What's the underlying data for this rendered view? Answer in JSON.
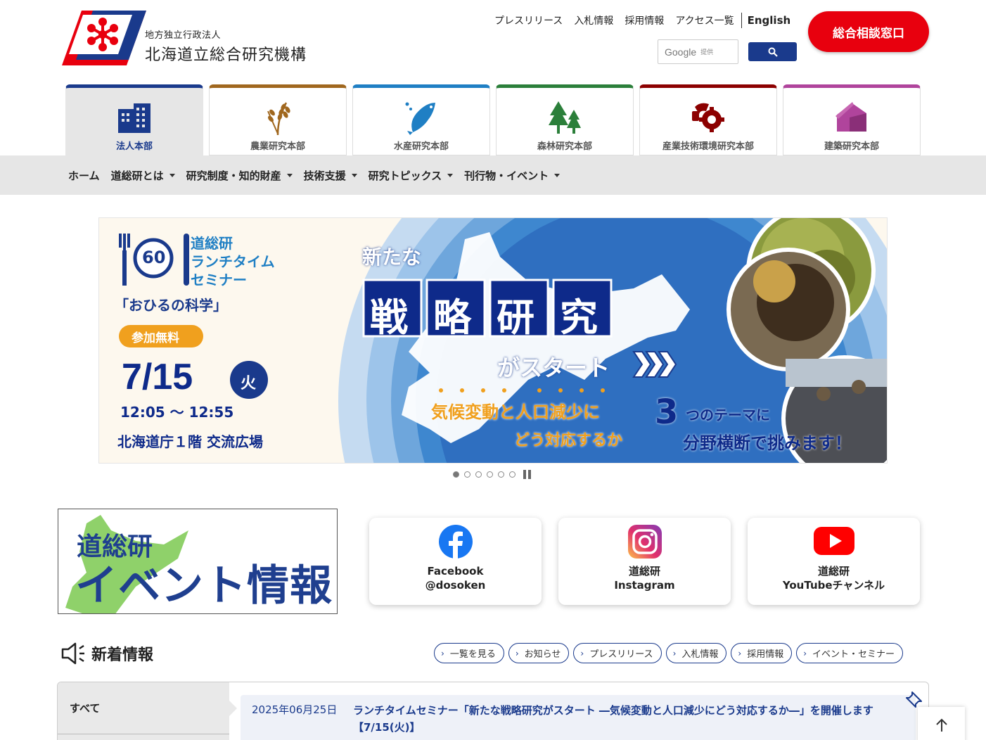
{
  "header": {
    "org_sub": "地方独立行政法人",
    "org_name": "北海道立総合研究機構",
    "top_links": [
      "プレスリリース",
      "入札情報",
      "採用情報",
      "アクセス一覧"
    ],
    "english": "English",
    "search_brand": "Google",
    "search_by": "提供",
    "consult_button": "総合相談窓口"
  },
  "dept_tabs": [
    {
      "label": "法人本部",
      "color": "#1a3a8c",
      "icon": "building-icon"
    },
    {
      "label": "農業研究本部",
      "color": "#a0671e",
      "icon": "rice-icon"
    },
    {
      "label": "水産研究本部",
      "color": "#1f7fc4",
      "icon": "fish-icon"
    },
    {
      "label": "森林研究本部",
      "color": "#2b7f3a",
      "icon": "trees-icon"
    },
    {
      "label": "産業技術環境研究本部",
      "color": "#8c0000",
      "icon": "gear-icon"
    },
    {
      "label": "建築研究本部",
      "color": "#b0449c",
      "icon": "house-icon"
    }
  ],
  "nav": {
    "items": [
      "ホーム",
      "道総研とは",
      "研究制度・知的財産",
      "技術支援",
      "研究トピックス",
      "刊行物・イベント"
    ]
  },
  "banner": {
    "badge_num": "60",
    "seminar_title_1": "道総研",
    "seminar_title_2": "ランチタイム",
    "seminar_title_3": "セミナー",
    "seminar_sub": "「おひるの科学」",
    "free": "参加無料",
    "date": "7/15",
    "weekday": "火",
    "time": "12:05 ～ 12:55",
    "venue": "北海道庁１階 交流広場",
    "new": "新たな",
    "strategy": [
      "戦",
      "略",
      "研",
      "究"
    ],
    "start": "がスタート",
    "theme_a": "気候変動と人口減少に",
    "theme_b": "どう対応するか",
    "three_num": "3",
    "three_text": "つのテーマに",
    "cross": "分野横断で挑みます！"
  },
  "carousel": {
    "slides": 6,
    "active": 0
  },
  "event_box": {
    "line1": "道総研",
    "line2": "イベント情報"
  },
  "social": [
    {
      "line1": "Facebook",
      "line2": "@dosoken",
      "icon": "facebook-icon"
    },
    {
      "line1": "道総研",
      "line2": "Instagram",
      "icon": "instagram-icon"
    },
    {
      "line1": "道総研",
      "line2": "YouTubeチャンネル",
      "icon": "youtube-icon"
    }
  ],
  "news": {
    "title": "新着情報",
    "links": [
      "一覧を見る",
      "お知らせ",
      "プレスリリース",
      "入札情報",
      "採用情報",
      "イベント・セミナー"
    ],
    "category": "すべて",
    "items": [
      {
        "date": "2025年06月25日",
        "title": "ランチタイムセミナー「新たな戦略研究がスタート ―気候変動と人口減少にどう対応するか―」を開催します【7/15(火)】"
      }
    ]
  }
}
